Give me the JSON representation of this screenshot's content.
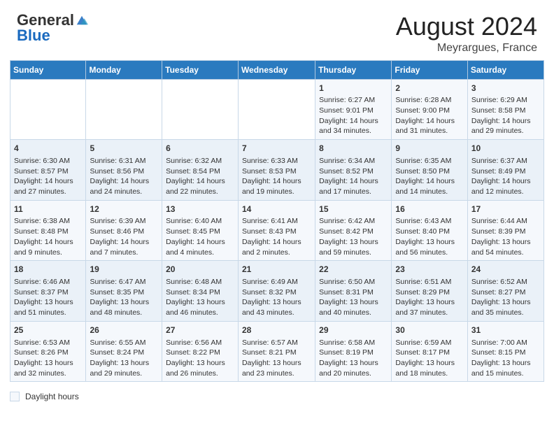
{
  "header": {
    "logo_general": "General",
    "logo_blue": "Blue",
    "month_year": "August 2024",
    "location": "Meyrargues, France"
  },
  "footer": {
    "daylight_label": "Daylight hours"
  },
  "weekdays": [
    "Sunday",
    "Monday",
    "Tuesday",
    "Wednesday",
    "Thursday",
    "Friday",
    "Saturday"
  ],
  "weeks": [
    [
      {
        "day": "",
        "info": ""
      },
      {
        "day": "",
        "info": ""
      },
      {
        "day": "",
        "info": ""
      },
      {
        "day": "",
        "info": ""
      },
      {
        "day": "1",
        "info": "Sunrise: 6:27 AM\nSunset: 9:01 PM\nDaylight: 14 hours and 34 minutes."
      },
      {
        "day": "2",
        "info": "Sunrise: 6:28 AM\nSunset: 9:00 PM\nDaylight: 14 hours and 31 minutes."
      },
      {
        "day": "3",
        "info": "Sunrise: 6:29 AM\nSunset: 8:58 PM\nDaylight: 14 hours and 29 minutes."
      }
    ],
    [
      {
        "day": "4",
        "info": "Sunrise: 6:30 AM\nSunset: 8:57 PM\nDaylight: 14 hours and 27 minutes."
      },
      {
        "day": "5",
        "info": "Sunrise: 6:31 AM\nSunset: 8:56 PM\nDaylight: 14 hours and 24 minutes."
      },
      {
        "day": "6",
        "info": "Sunrise: 6:32 AM\nSunset: 8:54 PM\nDaylight: 14 hours and 22 minutes."
      },
      {
        "day": "7",
        "info": "Sunrise: 6:33 AM\nSunset: 8:53 PM\nDaylight: 14 hours and 19 minutes."
      },
      {
        "day": "8",
        "info": "Sunrise: 6:34 AM\nSunset: 8:52 PM\nDaylight: 14 hours and 17 minutes."
      },
      {
        "day": "9",
        "info": "Sunrise: 6:35 AM\nSunset: 8:50 PM\nDaylight: 14 hours and 14 minutes."
      },
      {
        "day": "10",
        "info": "Sunrise: 6:37 AM\nSunset: 8:49 PM\nDaylight: 14 hours and 12 minutes."
      }
    ],
    [
      {
        "day": "11",
        "info": "Sunrise: 6:38 AM\nSunset: 8:48 PM\nDaylight: 14 hours and 9 minutes."
      },
      {
        "day": "12",
        "info": "Sunrise: 6:39 AM\nSunset: 8:46 PM\nDaylight: 14 hours and 7 minutes."
      },
      {
        "day": "13",
        "info": "Sunrise: 6:40 AM\nSunset: 8:45 PM\nDaylight: 14 hours and 4 minutes."
      },
      {
        "day": "14",
        "info": "Sunrise: 6:41 AM\nSunset: 8:43 PM\nDaylight: 14 hours and 2 minutes."
      },
      {
        "day": "15",
        "info": "Sunrise: 6:42 AM\nSunset: 8:42 PM\nDaylight: 13 hours and 59 minutes."
      },
      {
        "day": "16",
        "info": "Sunrise: 6:43 AM\nSunset: 8:40 PM\nDaylight: 13 hours and 56 minutes."
      },
      {
        "day": "17",
        "info": "Sunrise: 6:44 AM\nSunset: 8:39 PM\nDaylight: 13 hours and 54 minutes."
      }
    ],
    [
      {
        "day": "18",
        "info": "Sunrise: 6:46 AM\nSunset: 8:37 PM\nDaylight: 13 hours and 51 minutes."
      },
      {
        "day": "19",
        "info": "Sunrise: 6:47 AM\nSunset: 8:35 PM\nDaylight: 13 hours and 48 minutes."
      },
      {
        "day": "20",
        "info": "Sunrise: 6:48 AM\nSunset: 8:34 PM\nDaylight: 13 hours and 46 minutes."
      },
      {
        "day": "21",
        "info": "Sunrise: 6:49 AM\nSunset: 8:32 PM\nDaylight: 13 hours and 43 minutes."
      },
      {
        "day": "22",
        "info": "Sunrise: 6:50 AM\nSunset: 8:31 PM\nDaylight: 13 hours and 40 minutes."
      },
      {
        "day": "23",
        "info": "Sunrise: 6:51 AM\nSunset: 8:29 PM\nDaylight: 13 hours and 37 minutes."
      },
      {
        "day": "24",
        "info": "Sunrise: 6:52 AM\nSunset: 8:27 PM\nDaylight: 13 hours and 35 minutes."
      }
    ],
    [
      {
        "day": "25",
        "info": "Sunrise: 6:53 AM\nSunset: 8:26 PM\nDaylight: 13 hours and 32 minutes."
      },
      {
        "day": "26",
        "info": "Sunrise: 6:55 AM\nSunset: 8:24 PM\nDaylight: 13 hours and 29 minutes."
      },
      {
        "day": "27",
        "info": "Sunrise: 6:56 AM\nSunset: 8:22 PM\nDaylight: 13 hours and 26 minutes."
      },
      {
        "day": "28",
        "info": "Sunrise: 6:57 AM\nSunset: 8:21 PM\nDaylight: 13 hours and 23 minutes."
      },
      {
        "day": "29",
        "info": "Sunrise: 6:58 AM\nSunset: 8:19 PM\nDaylight: 13 hours and 20 minutes."
      },
      {
        "day": "30",
        "info": "Sunrise: 6:59 AM\nSunset: 8:17 PM\nDaylight: 13 hours and 18 minutes."
      },
      {
        "day": "31",
        "info": "Sunrise: 7:00 AM\nSunset: 8:15 PM\nDaylight: 13 hours and 15 minutes."
      }
    ]
  ]
}
